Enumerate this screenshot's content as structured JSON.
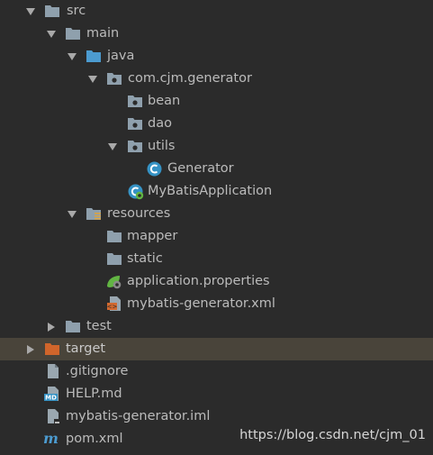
{
  "tree": {
    "src": "src",
    "main": "main",
    "java": "java",
    "package": "com.cjm.generator",
    "bean": "bean",
    "dao": "dao",
    "utils": "utils",
    "generator": "Generator",
    "app": "MyBatisApplication",
    "resources": "resources",
    "mapper": "mapper",
    "static": "static",
    "props": "application.properties",
    "genxml": "mybatis-generator.xml",
    "test": "test",
    "target": "target",
    "gitignore": ".gitignore",
    "help": "HELP.md",
    "iml": "mybatis-generator.iml",
    "pom": "pom.xml"
  },
  "watermark": "https://blog.csdn.net/cjm_01",
  "colors": {
    "background": "#2b2b2b",
    "selected_row": "#49443a",
    "folder": "#8fa0ad",
    "source_folder": "#4c9bd0",
    "excluded_folder": "#d0652b",
    "text": "#bbbbbb"
  }
}
